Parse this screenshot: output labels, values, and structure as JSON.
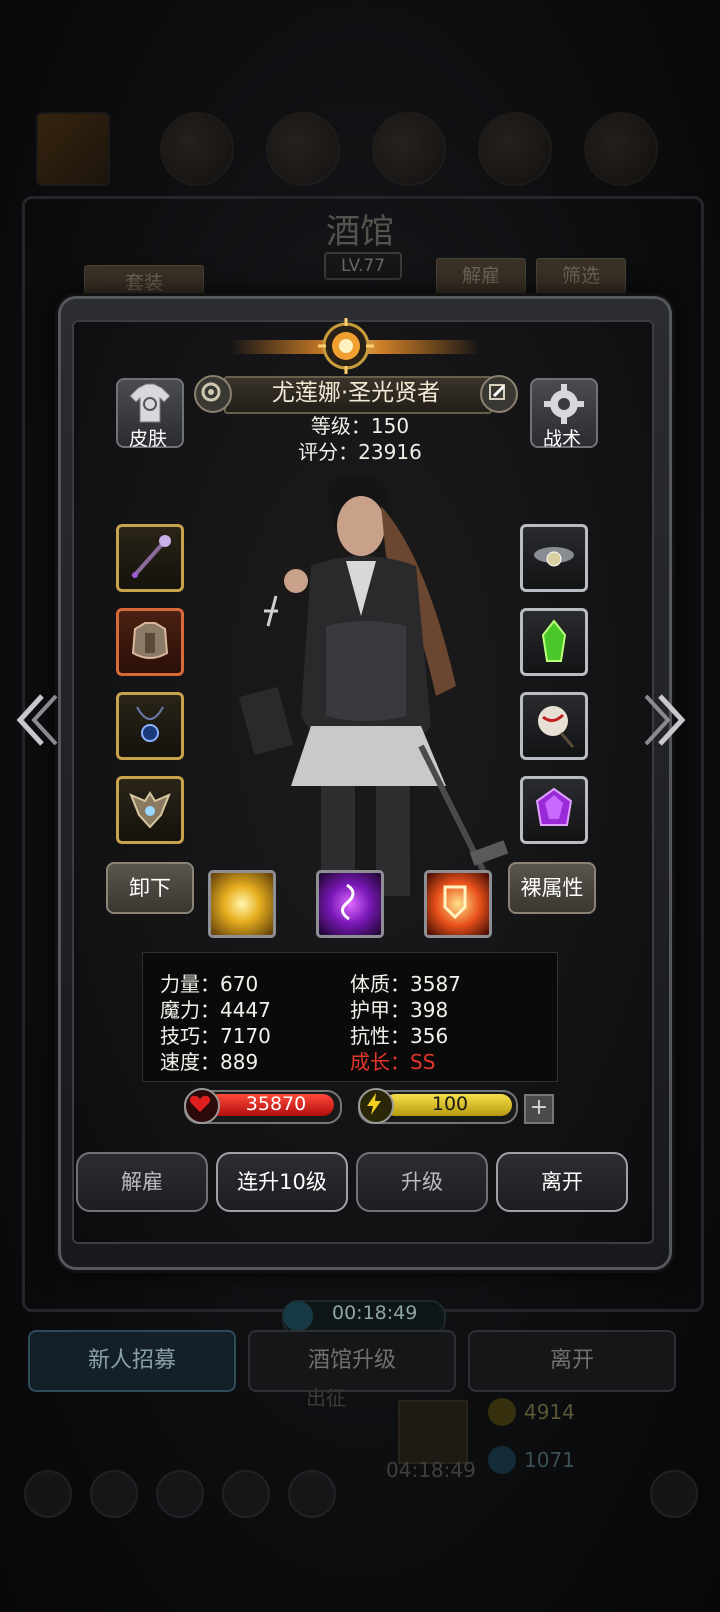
{
  "background": {
    "screen_title": "酒馆",
    "level": "LV.77",
    "left_button": "套装",
    "right_buttons": [
      "解雇",
      "筛选"
    ],
    "timer": "00:18:49",
    "bottom_buttons": [
      "新人招募",
      "酒馆升级",
      "离开"
    ],
    "march_label": "出征",
    "bottom_timer": "04:18:49",
    "resource_gold": "4914",
    "resource_gem": "1071"
  },
  "hero": {
    "name": "尤莲娜·圣光贤者",
    "level_line": "等级：150",
    "score_line": "评分：23916"
  },
  "side_buttons": {
    "skin": "皮肤",
    "tactics": "战术"
  },
  "equipment": {
    "left": [
      "staff-icon",
      "armor-icon",
      "amulet-icon",
      "emblem-icon"
    ],
    "right": [
      "cloud-orb-icon",
      "green-crystal-icon",
      "scroll-icon",
      "purple-gem-icon"
    ]
  },
  "skill_row": {
    "unequip": "卸下",
    "base_attributes": "裸属性",
    "skills": [
      "light-burst-icon",
      "holy-rune-icon",
      "flame-shield-icon"
    ]
  },
  "stats": {
    "strength": "力量：670",
    "magic": "魔力：4447",
    "skill": "技巧：7170",
    "speed": "速度：889",
    "constitution": "体质：3587",
    "armor": "护甲：398",
    "resistance": "抗性：356",
    "growth": "成长：SS"
  },
  "bars": {
    "hp": "35870",
    "energy": "100",
    "plus": "+"
  },
  "actions": {
    "dismiss": "解雇",
    "level_up_10": "连升10级",
    "level_up": "升级",
    "leave": "离开"
  },
  "colors": {
    "growth_red": "#e5352a",
    "hp_red": "#d01818",
    "energy_yellow": "#d8c21a",
    "gold_frame": "#c7a34c"
  }
}
